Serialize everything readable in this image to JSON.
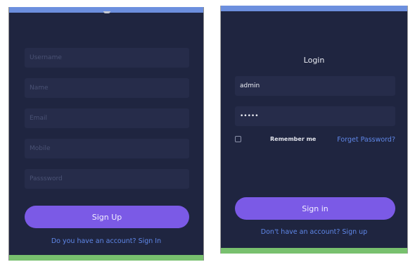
{
  "signup": {
    "fields": [
      {
        "name": "username-field",
        "placeholder": "Username"
      },
      {
        "name": "name-field",
        "placeholder": "Name"
      },
      {
        "name": "email-field",
        "placeholder": "Email"
      },
      {
        "name": "mobile-field",
        "placeholder": "Mobile"
      },
      {
        "name": "password-field",
        "placeholder": "Passsword"
      }
    ],
    "button_label": "Sign Up",
    "footer_link": "Do you have an account? Sign In"
  },
  "login": {
    "title": "Login",
    "username_value": "admin",
    "password_value": "•••••",
    "remember_label": "Remember me",
    "forget_label": "Forget Password?",
    "button_label": "Sign in",
    "footer_link": "Don't have an account? Sign up"
  },
  "colors": {
    "panel_bg": "#1f2540",
    "field_bg": "#262c4a",
    "accent_button": "#7b5ae6",
    "link": "#5f87e8",
    "top_bar": "#6c8fde",
    "bottom_bar": "#78c06e"
  }
}
